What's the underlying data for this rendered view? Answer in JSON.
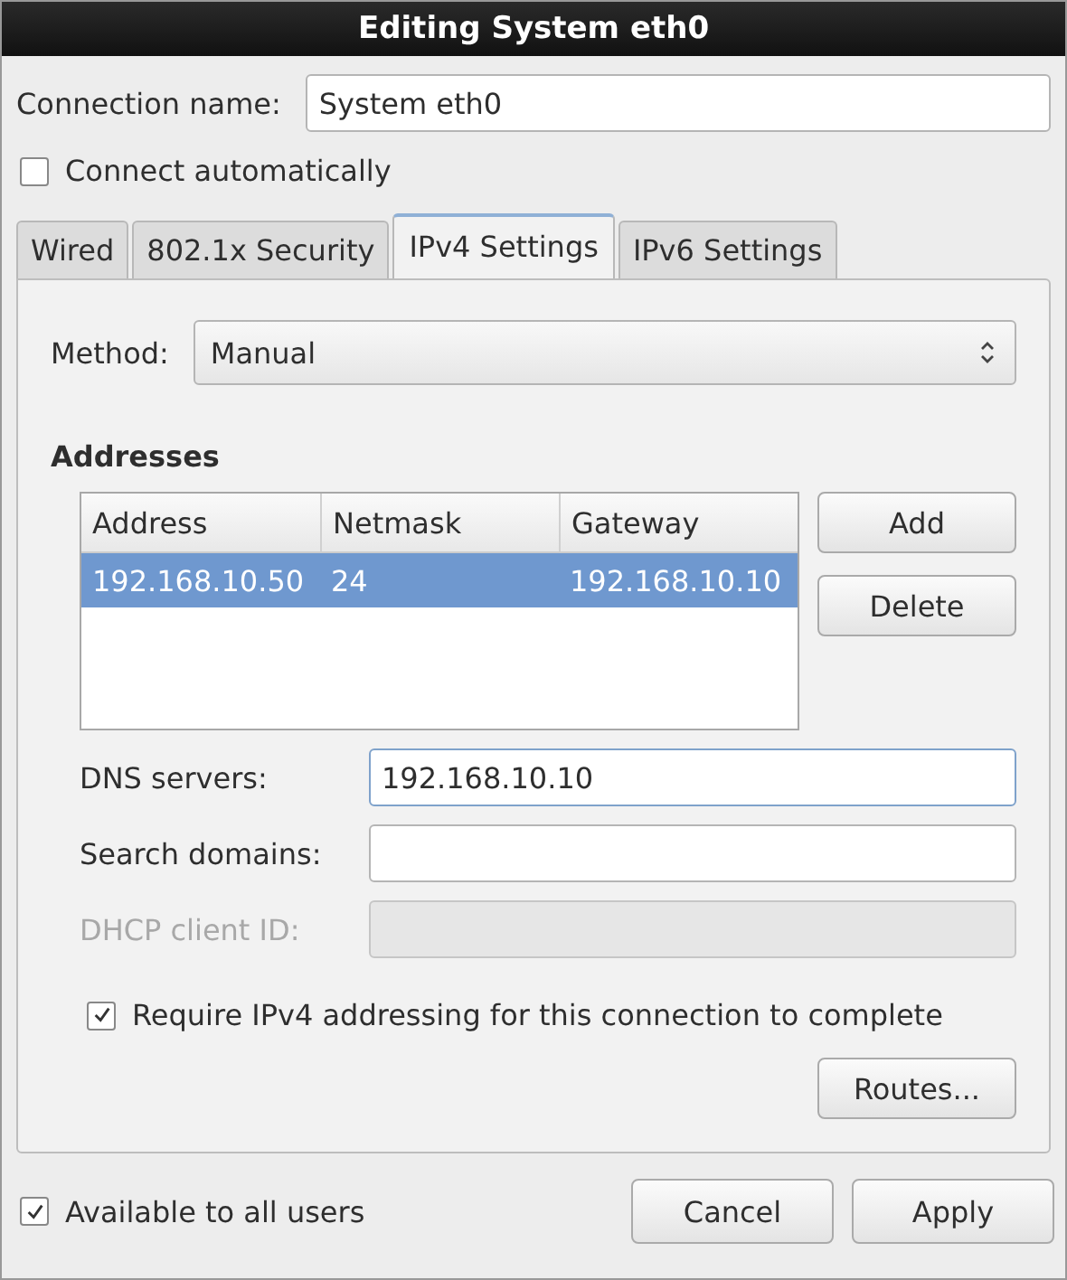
{
  "window": {
    "title": "Editing System eth0"
  },
  "connection_name": {
    "label": "Connection name:",
    "value": "System eth0"
  },
  "connect_automatically": {
    "label": "Connect automatically",
    "checked": false
  },
  "tabs": [
    {
      "label": "Wired",
      "selected": false
    },
    {
      "label": "802.1x Security",
      "selected": false
    },
    {
      "label": "IPv4 Settings",
      "selected": true
    },
    {
      "label": "IPv6 Settings",
      "selected": false
    }
  ],
  "method": {
    "label": "Method:",
    "value": "Manual"
  },
  "addresses": {
    "heading": "Addresses",
    "columns": [
      "Address",
      "Netmask",
      "Gateway"
    ],
    "rows": [
      {
        "cells": [
          "192.168.10.50",
          "24",
          "192.168.10.10"
        ],
        "selected": true
      }
    ],
    "buttons": [
      "Add",
      "Delete"
    ]
  },
  "fields": [
    {
      "label": "DNS servers:",
      "value": "192.168.10.10",
      "focused": true,
      "disabled": false
    },
    {
      "label": "Search domains:",
      "focused": false,
      "disabled": false
    },
    {
      "label": "DHCP client ID:",
      "focused": false,
      "disabled": true
    }
  ],
  "require_ipv4": {
    "label": "Require IPv4 addressing for this connection to complete",
    "checked": true
  },
  "routes_button": "Routes...",
  "available_to_all": {
    "label": "Available to all users",
    "checked": true
  },
  "buttons": [
    "Cancel",
    "Apply"
  ]
}
